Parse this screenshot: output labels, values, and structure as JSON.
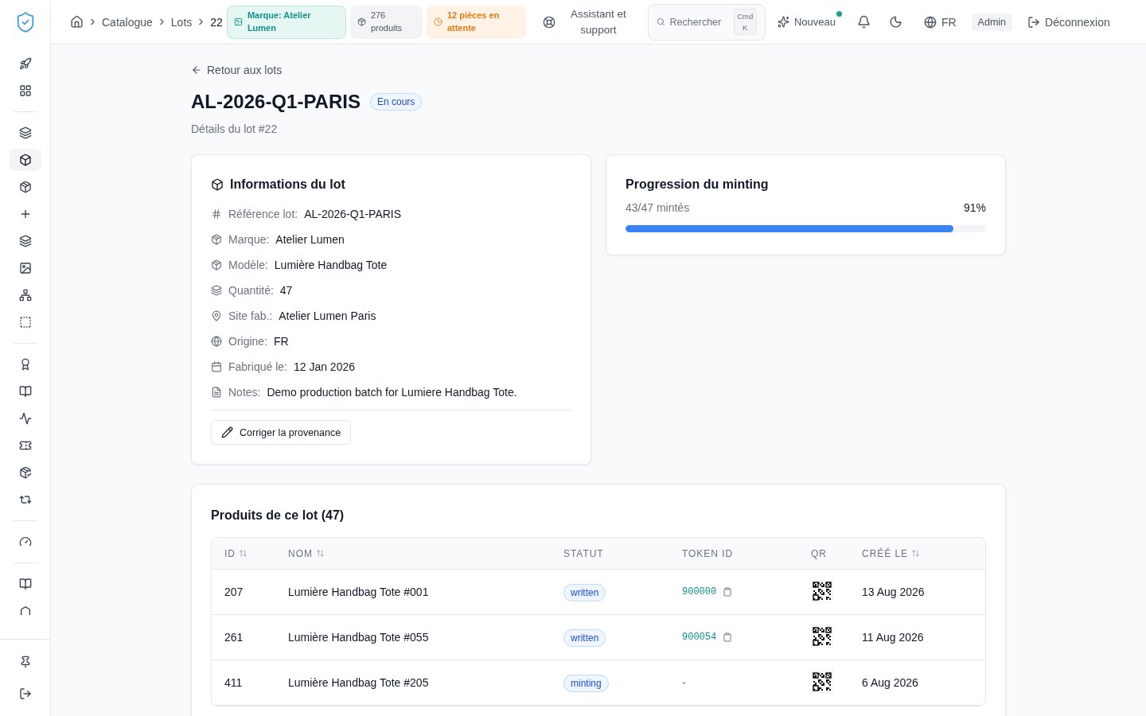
{
  "sidebar": {
    "groups": [
      {
        "items": [
          {
            "selected": false
          },
          {
            "selected": false
          }
        ]
      },
      {
        "items": [
          {
            "selected": false
          },
          {
            "selected": true
          },
          {
            "selected": false
          },
          {
            "selected": false
          },
          {
            "selected": false
          },
          {
            "selected": false
          },
          {
            "selected": false
          },
          {
            "selected": false
          }
        ]
      },
      {
        "items": [
          {
            "selected": false
          },
          {
            "selected": false
          },
          {
            "selected": false
          },
          {
            "selected": false
          },
          {
            "selected": false
          },
          {
            "selected": false
          }
        ]
      },
      {
        "items": [
          {
            "selected": false
          }
        ]
      },
      {
        "items": [
          {
            "selected": false
          },
          {
            "selected": false
          }
        ]
      }
    ],
    "footer": [
      {
        "selected": false
      },
      {
        "selected": false
      }
    ]
  },
  "header": {
    "breadcrumbs": [
      "Catalogue",
      "Lots",
      "22"
    ],
    "chips": [
      {
        "kind": "brand",
        "label": "Marque: Atelier Lumen"
      },
      {
        "kind": "count",
        "label": "276 produits"
      },
      {
        "kind": "pending",
        "label": "12 pièces en attente"
      }
    ],
    "support": "Assistant et support",
    "search": {
      "placeholder": "Rechercher",
      "shortcut": "Cmd K"
    },
    "new": {
      "label": "Nouveau",
      "unread": true
    },
    "language": "FR",
    "role": "Admin",
    "logout": "Déconnexion"
  },
  "back": "Retour aux lots",
  "title": "AL-2026-Q1-PARIS",
  "status": "En cours",
  "subtitle": "Détails du lot #22",
  "info": {
    "title": "Informations du lot",
    "rows": [
      {
        "label": "Référence lot:",
        "value": "AL-2026-Q1-PARIS"
      },
      {
        "label": "Marque:",
        "value": "Atelier Lumen"
      },
      {
        "label": "Modèle:",
        "value": "Lumière Handbag Tote"
      },
      {
        "label": "Quantité:",
        "value": "47"
      },
      {
        "label": "Site fab.:",
        "value": "Atelier Lumen Paris"
      },
      {
        "label": "Origine:",
        "value": "FR"
      },
      {
        "label": "Fabriqué le:",
        "value": "12 Jan 2026"
      },
      {
        "label": "Notes:",
        "value": "Demo production batch for Lumiere Handbag Tote."
      }
    ],
    "action": "Corriger la provenance"
  },
  "progress": {
    "title": "Progression du minting",
    "count": "43/47 mintés",
    "percent": "91%",
    "level": 0.91
  },
  "products": {
    "title": "Produits de ce lot (47)",
    "columns": [
      {
        "label": "ID",
        "sortable": true
      },
      {
        "label": "NOM",
        "sortable": true
      },
      {
        "label": "STATUT",
        "sortable": false
      },
      {
        "label": "TOKEN ID",
        "sortable": false
      },
      {
        "label": "QR",
        "sortable": false
      },
      {
        "label": "CRÉÉ LE",
        "sortable": true
      }
    ],
    "rows": [
      {
        "id": "207",
        "name": "Lumière Handbag Tote #001",
        "status": "written",
        "token": "900000",
        "created": "13 Aug 2026"
      },
      {
        "id": "261",
        "name": "Lumière Handbag Tote #055",
        "status": "written",
        "token": "900054",
        "created": "11 Aug 2026"
      },
      {
        "id": "411",
        "name": "Lumière Handbag Tote #205",
        "status": "minting",
        "token": "-",
        "created": "6 Aug 2026"
      }
    ]
  }
}
